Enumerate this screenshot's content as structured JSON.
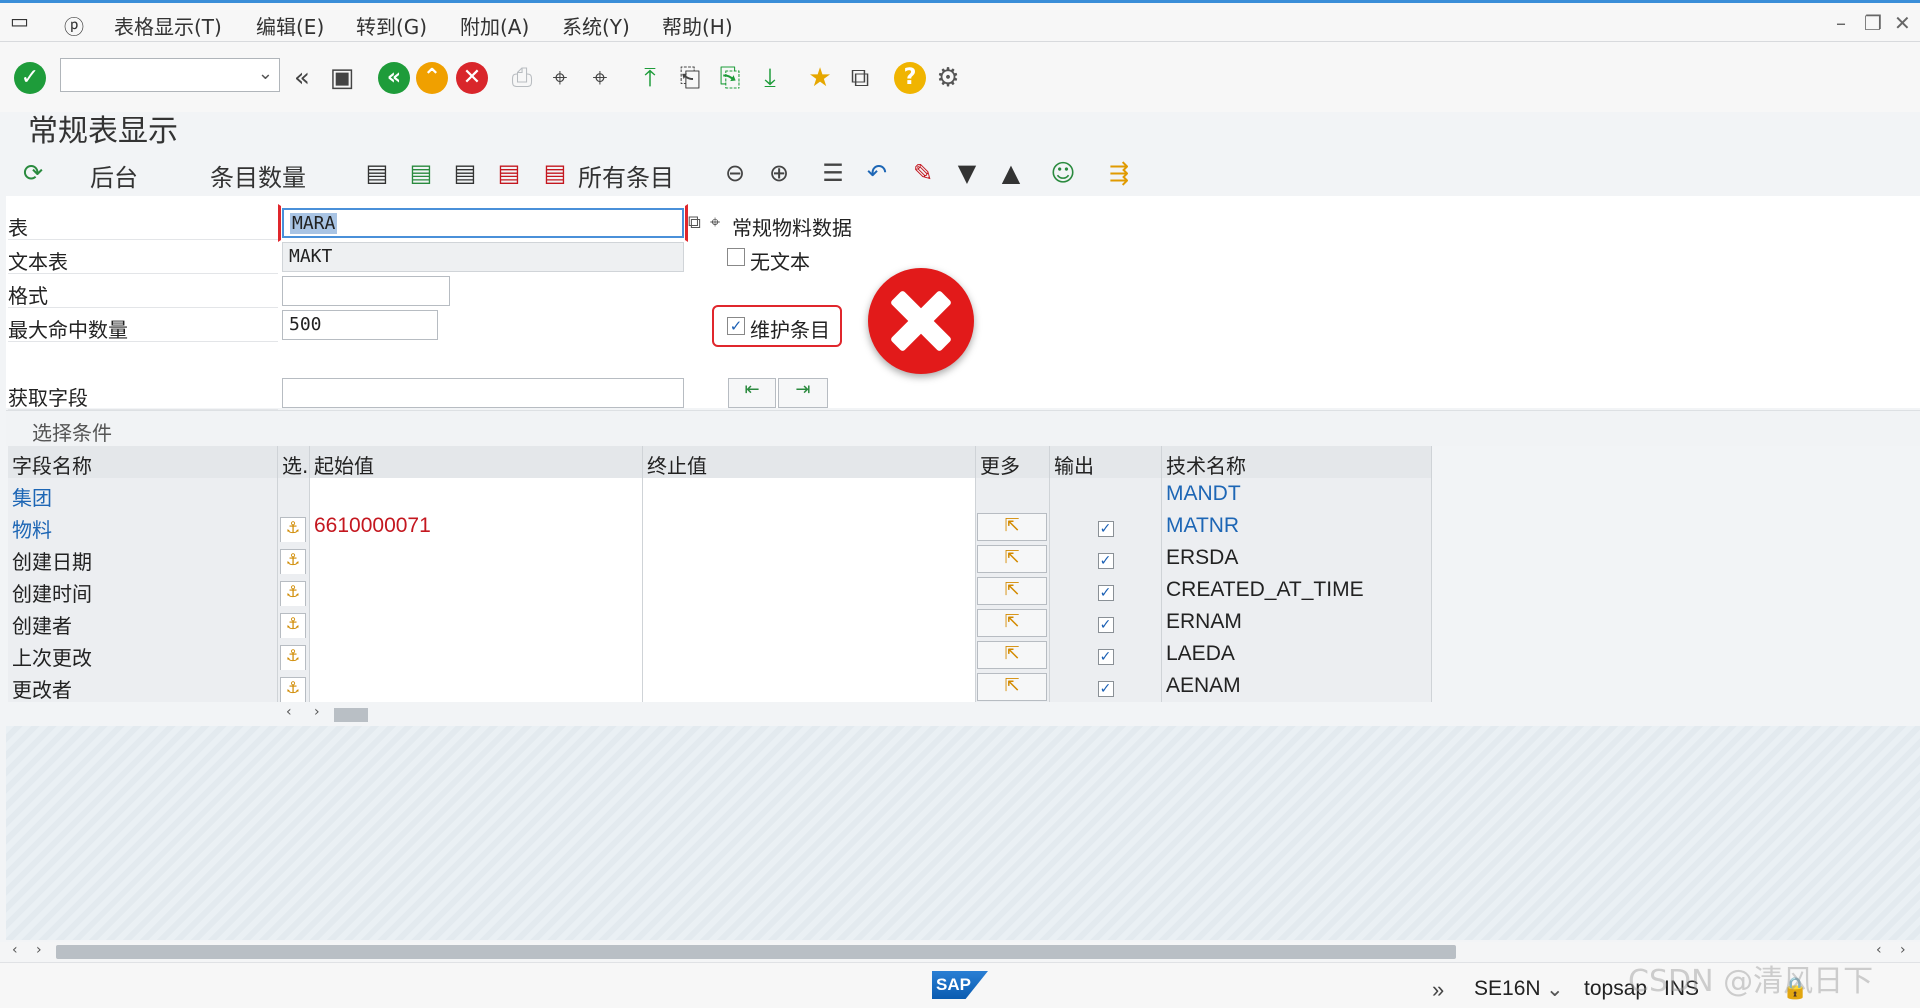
{
  "menubar": {
    "items": [
      "表格显示(T)",
      "编辑(E)",
      "转到(G)",
      "附加(A)",
      "系统(Y)",
      "帮助(H)"
    ],
    "win_controls": [
      "–",
      "❐",
      "✕"
    ]
  },
  "toolbar": {
    "command_value": ""
  },
  "page": {
    "title": "常规表显示"
  },
  "app_toolbar": {
    "background_label": "后台",
    "entries_count_label": "条目数量",
    "all_entries_label": "所有条目"
  },
  "form": {
    "table_label": "表",
    "table_value": "MARA",
    "table_desc": "常规物料数据",
    "text_table_label": "文本表",
    "text_table_value": "MAKT",
    "no_text_label": "无文本",
    "format_label": "格式",
    "format_value": "",
    "max_hits_label": "最大命中数量",
    "max_hits_value": "500",
    "maintain_label": "维护条目",
    "get_fields_label": "获取字段",
    "get_fields_value": ""
  },
  "selection": {
    "header": "选择条件",
    "columns": [
      "字段名称",
      "选.",
      "起始值",
      "终止值",
      "更多",
      "输出",
      "技术名称"
    ],
    "rows": [
      {
        "field": "集团",
        "from": "",
        "to": "",
        "has_more": false,
        "output": false,
        "tech": "MANDT",
        "link": true
      },
      {
        "field": "物料",
        "from": "6610000071",
        "to": "",
        "has_more": true,
        "output": true,
        "tech": "MATNR",
        "link": true
      },
      {
        "field": "创建日期",
        "from": "",
        "to": "",
        "has_more": true,
        "output": true,
        "tech": "ERSDA",
        "link": false
      },
      {
        "field": "创建时间",
        "from": "",
        "to": "",
        "has_more": true,
        "output": true,
        "tech": "CREATED_AT_TIME",
        "link": false
      },
      {
        "field": "创建者",
        "from": "",
        "to": "",
        "has_more": true,
        "output": true,
        "tech": "ERNAM",
        "link": false
      },
      {
        "field": "上次更改",
        "from": "",
        "to": "",
        "has_more": true,
        "output": true,
        "tech": "LAEDA",
        "link": false
      },
      {
        "field": "更改者",
        "from": "",
        "to": "",
        "has_more": true,
        "output": true,
        "tech": "AENAM",
        "link": false
      }
    ]
  },
  "status": {
    "logo": "SAP",
    "transaction": "SE16N",
    "system": "topsap",
    "mode": "INS",
    "watermark": "CSDN @清风日下"
  },
  "colors": {
    "accent_blue": "#1d66b5",
    "error_red": "#e21a1a",
    "value_red": "#c4171f",
    "ok_green": "#1e9c3a"
  }
}
